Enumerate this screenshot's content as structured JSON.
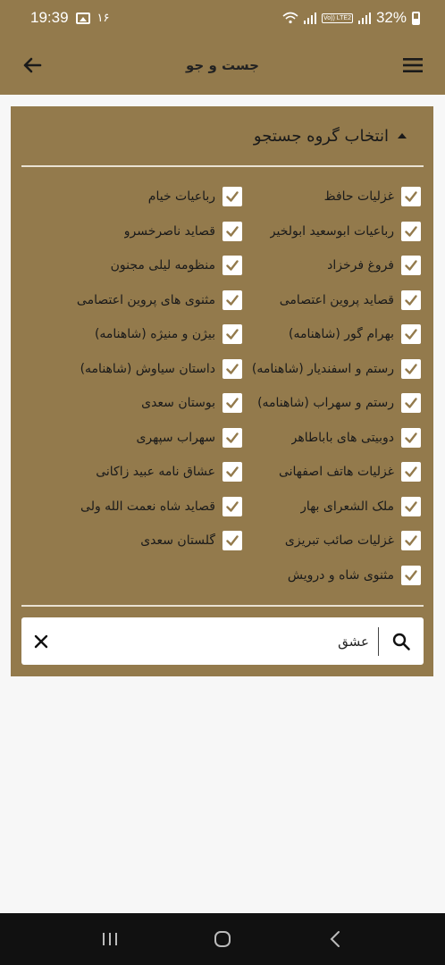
{
  "status_bar": {
    "time": "19:39",
    "notification_count": "۱۶",
    "battery": "32%",
    "lte_label": "Vo)) LTE2"
  },
  "app_bar": {
    "title": "جست و جو"
  },
  "group_section": {
    "title": "انتخاب گروه جستجو",
    "items": [
      {
        "label": "غزلیات حافظ",
        "checked": true
      },
      {
        "label": "رباعیات خیام",
        "checked": true
      },
      {
        "label": "رباعیات ابوسعید ابولخیر",
        "checked": true
      },
      {
        "label": "قصاید ناصرخسرو",
        "checked": true
      },
      {
        "label": "فروغ فرخزاد",
        "checked": true
      },
      {
        "label": "منظومه لیلی مجنون",
        "checked": true
      },
      {
        "label": "قصاید پروین اعتصامی",
        "checked": true
      },
      {
        "label": "مثنوی های پروین اعتصامی",
        "checked": true
      },
      {
        "label": "بهرام گور (شاهنامه)",
        "checked": true
      },
      {
        "label": "بیژن و منیژه (شاهنامه)",
        "checked": true
      },
      {
        "label": "رستم و اسفندیار (شاهنامه)",
        "checked": true
      },
      {
        "label": "داستان سیاوش (شاهنامه)",
        "checked": true
      },
      {
        "label": "رستم و سهراب (شاهنامه)",
        "checked": true
      },
      {
        "label": "بوستان سعدی",
        "checked": true
      },
      {
        "label": "دوبیتی های باباطاهر",
        "checked": true
      },
      {
        "label": "سهراب سپهری",
        "checked": true
      },
      {
        "label": "غزلیات هاتف اصفهانی",
        "checked": true
      },
      {
        "label": "عشاق نامه عبید زاکانی",
        "checked": true
      },
      {
        "label": "ملک الشعرای بهار",
        "checked": true
      },
      {
        "label": "قصاید شاه نعمت الله ولی",
        "checked": true
      },
      {
        "label": "غزلیات صائب تبریزی",
        "checked": true
      },
      {
        "label": "گلستان سعدی",
        "checked": true
      },
      {
        "label": "مثنوی شاه و درویش",
        "checked": true
      }
    ]
  },
  "search": {
    "value": "عشق"
  },
  "colors": {
    "primary": "#937a4c",
    "background": "#f7f7f7"
  },
  "icons": {
    "menu": "hamburger-icon",
    "back": "arrow-left-icon",
    "collapse": "triangle-up-icon",
    "check": "checkmark-icon",
    "search": "magnifier-icon",
    "clear": "close-icon"
  }
}
